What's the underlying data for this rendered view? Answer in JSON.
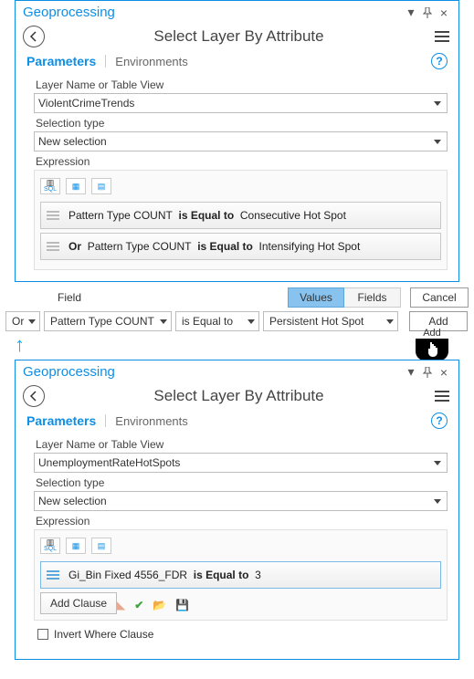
{
  "panel1": {
    "title": "Geoprocessing",
    "tool_title": "Select Layer By Attribute",
    "tabs": {
      "active": "Parameters",
      "inactive": "Environments"
    },
    "layer_label": "Layer Name or Table View",
    "layer_value": "ViolentCrimeTrends",
    "seltype_label": "Selection type",
    "seltype_value": "New selection",
    "expr_label": "Expression",
    "clauses": [
      {
        "prefix": "",
        "text_before": "Pattern Type COUNT",
        "op": "is Equal to",
        "value": "Consecutive Hot Spot"
      },
      {
        "prefix": "Or",
        "text_before": "Pattern Type COUNT",
        "op": "is Equal to",
        "value": "Intensifying Hot Spot"
      }
    ]
  },
  "builder": {
    "field_label": "Field",
    "values_btn": "Values",
    "fields_btn": "Fields",
    "cancel_btn": "Cancel",
    "add_btn": "Add",
    "logic": "Or",
    "field": "Pattern Type COUNT",
    "op": "is Equal to",
    "value": "Persistent Hot Spot",
    "cursor_label": "Add"
  },
  "panel2": {
    "title": "Geoprocessing",
    "tool_title": "Select Layer By Attribute",
    "tabs": {
      "active": "Parameters",
      "inactive": "Environments"
    },
    "layer_label": "Layer Name or Table View",
    "layer_value": "UnemploymentRateHotSpots",
    "seltype_label": "Selection type",
    "seltype_value": "New selection",
    "expr_label": "Expression",
    "clause": {
      "text_before": "Gi_Bin Fixed 4556_FDR",
      "op": "is Equal to",
      "value": "3"
    },
    "add_clause": "Add Clause",
    "invert_label": "Invert Where Clause"
  }
}
